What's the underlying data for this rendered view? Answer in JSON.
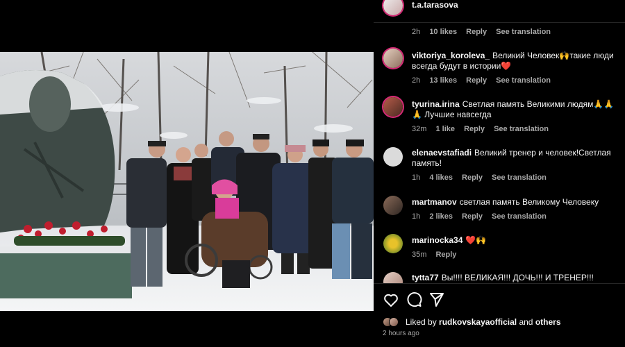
{
  "colors": {
    "background": "#000000",
    "text": "#f5f5f5",
    "muted": "#a8a8a8",
    "heart": "#ff3040"
  },
  "photo": {
    "alt": ""
  },
  "comments": [
    {
      "username": "t.a.tarasova",
      "text": "",
      "time": "2h",
      "likes": "10 likes",
      "reply": "Reply",
      "translate": "See translation"
    },
    {
      "username": "viktoriya_koroleva_",
      "text": "Великий Человек🙌такие люди всегда будут в истории❤️",
      "time": "2h",
      "likes": "13 likes",
      "reply": "Reply",
      "translate": "See translation"
    },
    {
      "username": "tyurina.irina",
      "text": "Светлая память Великими людям🙏🙏🙏 Лучшие навсегда",
      "time": "32m",
      "likes": "1 like",
      "reply": "Reply",
      "translate": "See translation"
    },
    {
      "username": "elenaevstafiadi",
      "text": "Великий тренер и человек!Светлая память!",
      "time": "1h",
      "likes": "4 likes",
      "reply": "Reply",
      "translate": "See translation"
    },
    {
      "username": "martmanov",
      "text": "светлая память Великому Человеку",
      "time": "1h",
      "likes": "2 likes",
      "reply": "Reply",
      "translate": "See translation"
    },
    {
      "username": "marinocka34",
      "text": "❤️🙌",
      "time": "35m",
      "reply": "Reply"
    },
    {
      "username": "tytta77",
      "text": "Вы!!!! ВЕЛИКАЯ!!! ДОЧЬ!!! И ТРЕНЕР!!!"
    }
  ],
  "actions": {
    "like_icon": "heart-icon",
    "comment_icon": "comment-icon",
    "share_icon": "share-icon"
  },
  "liked_by": {
    "prefix": "Liked by",
    "user": "rudkovskayaofficial",
    "and": "and",
    "others": "others"
  },
  "post_time": "2 hours ago"
}
